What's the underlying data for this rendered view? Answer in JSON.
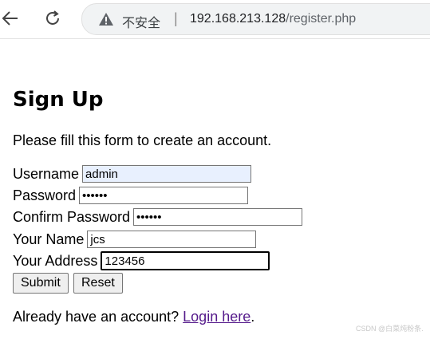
{
  "browser": {
    "insecure_label": "不安全",
    "separator": "|",
    "url_host": "192.168.213.128",
    "url_path": "/register.php"
  },
  "page": {
    "title": "Sign Up",
    "intro": "Please fill this form to create an account."
  },
  "form": {
    "username_label": "Username",
    "username_value": "admin",
    "password_label": "Password",
    "password_value": "••••••",
    "confirm_label": "Confirm Password",
    "confirm_value": "••••••",
    "name_label": "Your Name",
    "name_value": "jcs",
    "address_label": "Your Address",
    "address_value": "123456",
    "submit_label": "Submit",
    "reset_label": "Reset"
  },
  "footer": {
    "prefix": "Already have an account? ",
    "link_text": "Login here",
    "suffix": "."
  },
  "watermark": "CSDN @白菜炖粉条."
}
